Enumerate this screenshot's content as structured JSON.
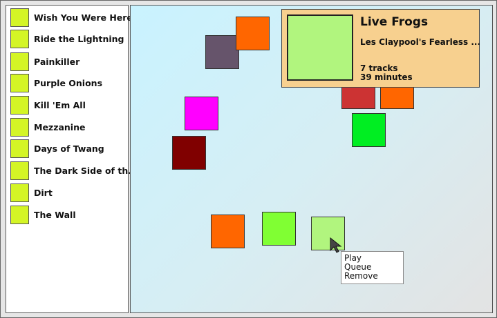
{
  "sidebar": {
    "items": [
      {
        "label": "Wish You Were Here",
        "color": "#d4f526"
      },
      {
        "label": "Ride the Lightning",
        "color": "#d4f526"
      },
      {
        "label": "Painkiller",
        "color": "#d4f526"
      },
      {
        "label": "Purple Onions",
        "color": "#d4f526"
      },
      {
        "label": "Kill 'Em All",
        "color": "#d4f526"
      },
      {
        "label": "Mezzanine",
        "color": "#d4f526"
      },
      {
        "label": "Days of Twang",
        "color": "#d4f526"
      },
      {
        "label": "The Dark Side of th...",
        "color": "#d4f526"
      },
      {
        "label": "Dirt",
        "color": "#d4f526"
      },
      {
        "label": "The Wall",
        "color": "#d4f526"
      }
    ]
  },
  "canvas": {
    "tiles": [
      {
        "name": "tile-slate",
        "color": "#66546b"
      },
      {
        "name": "tile-orange-top",
        "color": "#ff6600"
      },
      {
        "name": "tile-magenta",
        "color": "#ff00ff"
      },
      {
        "name": "tile-maroon",
        "color": "#800000"
      },
      {
        "name": "tile-red",
        "color": "#cc3333"
      },
      {
        "name": "tile-orange-right",
        "color": "#ff6600"
      },
      {
        "name": "tile-green",
        "color": "#00ee22"
      },
      {
        "name": "tile-orange-bottom",
        "color": "#ff6600"
      },
      {
        "name": "tile-lime",
        "color": "#80ff33"
      },
      {
        "name": "tile-hovered",
        "color": "#b1f57e"
      }
    ]
  },
  "details": {
    "title": "Live Frogs",
    "artist": "Les Claypool's Fearless ...",
    "tracks": "7 tracks",
    "minutes": "39 minutes",
    "cover_color": "#b1f57e",
    "panel_color": "#f7d08f"
  },
  "context_menu": {
    "items": [
      "Play",
      "Queue",
      "Remove"
    ]
  },
  "cursor": {
    "icon": "arrow-cursor-icon"
  }
}
